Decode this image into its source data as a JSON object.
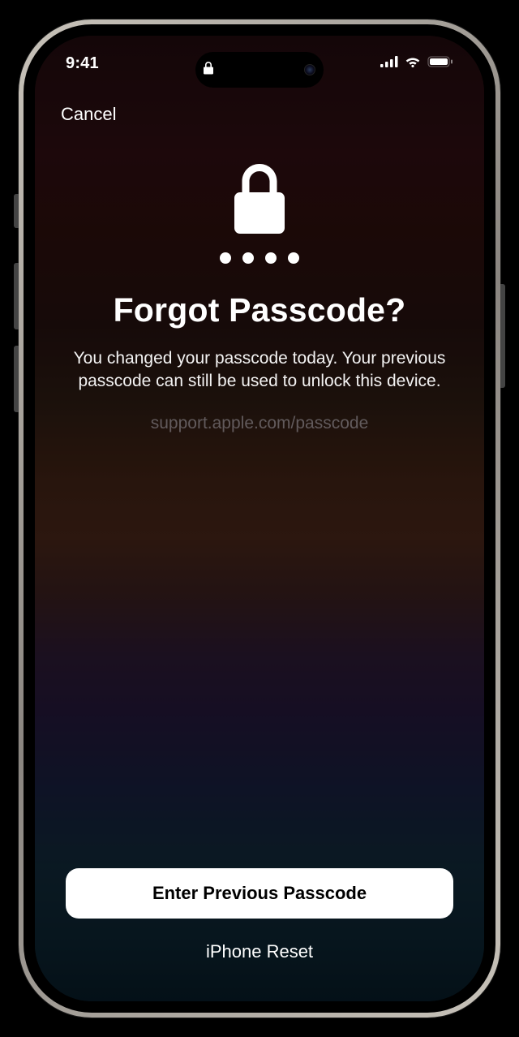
{
  "status_bar": {
    "time": "9:41"
  },
  "nav": {
    "cancel_label": "Cancel"
  },
  "main": {
    "title": "Forgot Passcode?",
    "subtitle": "You changed your passcode today. Your previous passcode can still be used to unlock this device.",
    "support_link": "support.apple.com/passcode"
  },
  "actions": {
    "primary_label": "Enter Previous Passcode",
    "secondary_label": "iPhone Reset"
  }
}
